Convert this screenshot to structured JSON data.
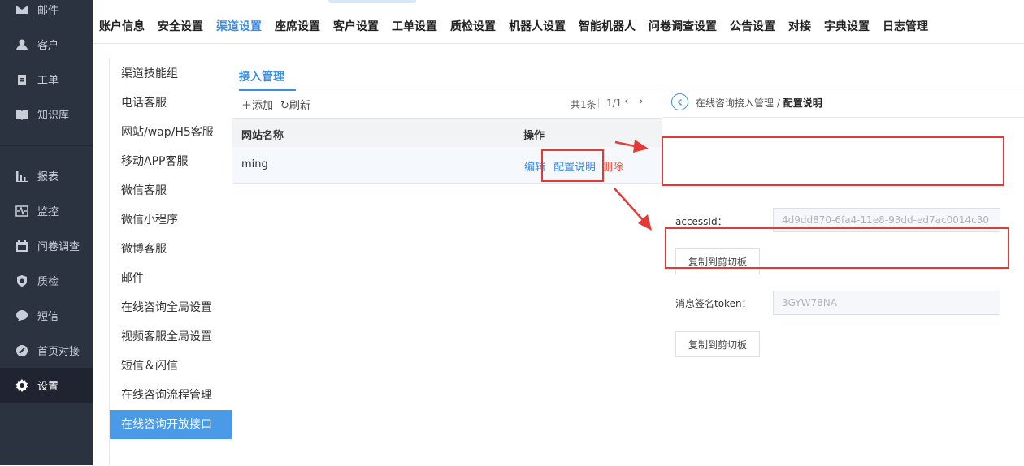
{
  "sidebar": {
    "items": [
      {
        "label": "邮件",
        "icon": "mail-icon"
      },
      {
        "label": "客户",
        "icon": "user-icon"
      },
      {
        "label": "工单",
        "icon": "clipboard-icon"
      },
      {
        "label": "知识库",
        "icon": "book-icon"
      },
      {
        "label": "报表",
        "icon": "bar-chart-icon"
      },
      {
        "label": "监控",
        "icon": "pulse-icon"
      },
      {
        "label": "问卷调查",
        "icon": "calendar-icon"
      },
      {
        "label": "质检",
        "icon": "shield-icon"
      },
      {
        "label": "短信",
        "icon": "chat-icon"
      },
      {
        "label": "首页对接",
        "icon": "link-icon"
      },
      {
        "label": "设置",
        "icon": "gear-icon"
      }
    ],
    "active": "设置"
  },
  "top_tabs": [
    "账户信息",
    "安全设置",
    "渠道设置",
    "座席设置",
    "客户设置",
    "工单设置",
    "质检设置",
    "机器人设置",
    "智能机器人",
    "问卷调查设置",
    "公告设置",
    "对接",
    "宇典设置",
    "日志管理"
  ],
  "top_tabs_active": "渠道设置",
  "menu": {
    "items": [
      "渠道技能组",
      "电话客服",
      "网站/wap/H5客服",
      "移动APP客服",
      "微信客服",
      "微信小程序",
      "微博客服",
      "邮件",
      "在线咨询全局设置",
      "视频客服全局设置",
      "短信＆闪信",
      "在线咨询流程管理",
      "在线咨询开放接口"
    ],
    "active": "在线咨询开放接口"
  },
  "panel": {
    "tab": "接入管理"
  },
  "list": {
    "add_label": "添加",
    "refresh_label": "刷新",
    "total": "共1条",
    "page": "1/1",
    "columns": [
      "网站名称",
      "操作"
    ],
    "rows": [
      {
        "name": "ming",
        "actions": [
          "编辑",
          "配置说明",
          "删除"
        ]
      }
    ]
  },
  "detail": {
    "breadcrumb_parent": "在线咨询接入管理 /",
    "breadcrumb_current": "配置说明",
    "access_id_label": "accessId：",
    "access_id_value": "4d9dd870-6fa4-11e8-93dd-ed7ac0014c30",
    "token_label": "消息签名token：",
    "token_value": "3GYW78NA",
    "copy_label": "复制到剪切板"
  },
  "colors": {
    "accent": "#3a8ee6",
    "sidebar_bg": "#2b3240",
    "annotation": "#e53935",
    "delete": "#e74c3c"
  }
}
